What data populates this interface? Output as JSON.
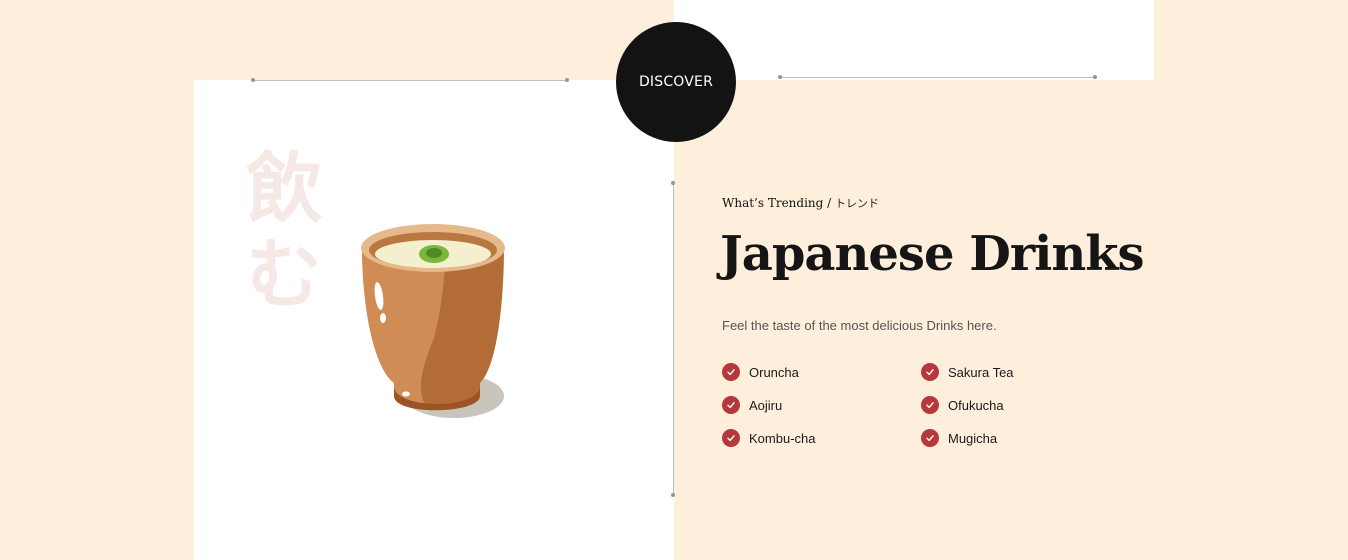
{
  "hero": {
    "discover_label": "DISCOVER",
    "kanji_line_1": "飲",
    "kanji_line_2": "む",
    "cup_image": "tea-cup-illustration"
  },
  "content": {
    "eyebrow": "What’s Trending",
    "eyebrow_separator": " / ",
    "eyebrow_jp": "トレンド",
    "title": "Japanese Drinks",
    "subtitle": "Feel the taste of the most delicious Drinks here."
  },
  "checklist": {
    "icon": "check-icon",
    "items": [
      "Oruncha",
      "Sakura Tea",
      "Aojiru",
      "Ofukucha",
      "Kombu-cha",
      "Mugicha"
    ]
  },
  "colors": {
    "background": "#feefdc",
    "panel": "#ffffff",
    "discover_circle": "#131313",
    "check_accent": "#b5393c",
    "kanji": "#f5e8e5"
  }
}
